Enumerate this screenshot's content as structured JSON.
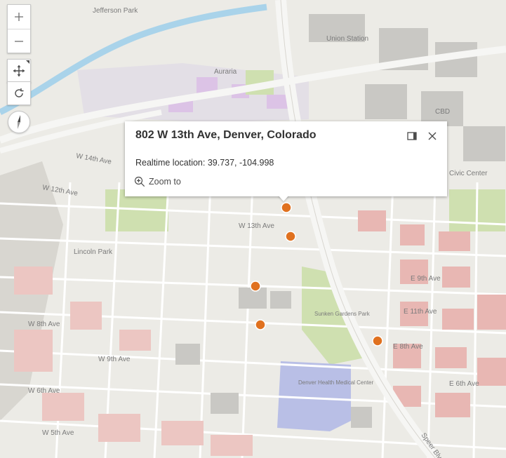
{
  "map": {
    "labels": [
      "Jefferson Park",
      "Union Station",
      "Auraria",
      "CBD",
      "W 14th Ave",
      "W 12th Ave",
      "Lincoln Park",
      "W 8th Ave",
      "W 6th Ave",
      "W 5th Ave",
      "W 9th Ave",
      "E 11th Ave",
      "E 8th Ave",
      "E 6th Ave",
      "Denver Health Medical Center",
      "Sunken Gardens Park",
      "Civic Center",
      "E 9th Ave",
      "Speer Blvd",
      "W 13th Ave"
    ],
    "colors": {
      "background": "#ecebe6",
      "block": "#dcdad4",
      "building_res": "#e8b7b3",
      "building_gray": "#c9c8c4",
      "park": "#cfe0b0",
      "campus": "#dcc3e6",
      "hospital": "#b9bfe6",
      "river": "#a9d3ea",
      "highway": "#f6f6f4",
      "marker": "#e0711f"
    }
  },
  "controls": {
    "zoom_in_icon": "plus-icon",
    "zoom_out_icon": "minus-icon",
    "pan_icon": "move-arrows-icon",
    "rotate_icon": "rotate-icon",
    "compass_icon": "compass-icon"
  },
  "popup": {
    "title": "802 W 13th Ave, Denver, Colorado",
    "body": "Realtime location: 39.737, -104.998",
    "zoom_to_label": "Zoom to",
    "dock_icon": "dock-icon",
    "close_icon": "close-icon"
  },
  "markers": [
    {
      "name": "selected-location-marker"
    },
    {
      "name": "location-marker"
    },
    {
      "name": "location-marker"
    },
    {
      "name": "location-marker"
    },
    {
      "name": "location-marker"
    }
  ]
}
